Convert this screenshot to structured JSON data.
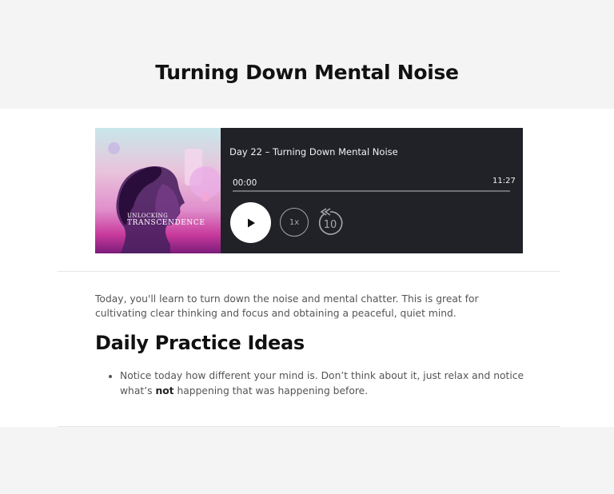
{
  "page": {
    "title": "Turning Down Mental Noise"
  },
  "player": {
    "cover": {
      "line1": "UNLOCKING",
      "line2": "TRANSCENDENCE"
    },
    "episode_title": "Day 22 – Turning Down Mental Noise",
    "time_current": "00:00",
    "time_total": "11:27",
    "progress": 0,
    "speed_label": "1x",
    "rewind_seconds": "10",
    "accent_color": "#202228"
  },
  "content": {
    "intro": "Today, you'll learn to turn down the noise and mental chatter. This is great for cultivating clear thinking and focus and obtaining a peaceful, quiet mind.",
    "section_heading": "Daily Practice Ideas",
    "practice_items": [
      {
        "text_before": "Notice today how different your mind is. Don’t think about it, just relax and notice what’s ",
        "emphasis": "not",
        "text_after": " happening that was happening before."
      }
    ]
  }
}
